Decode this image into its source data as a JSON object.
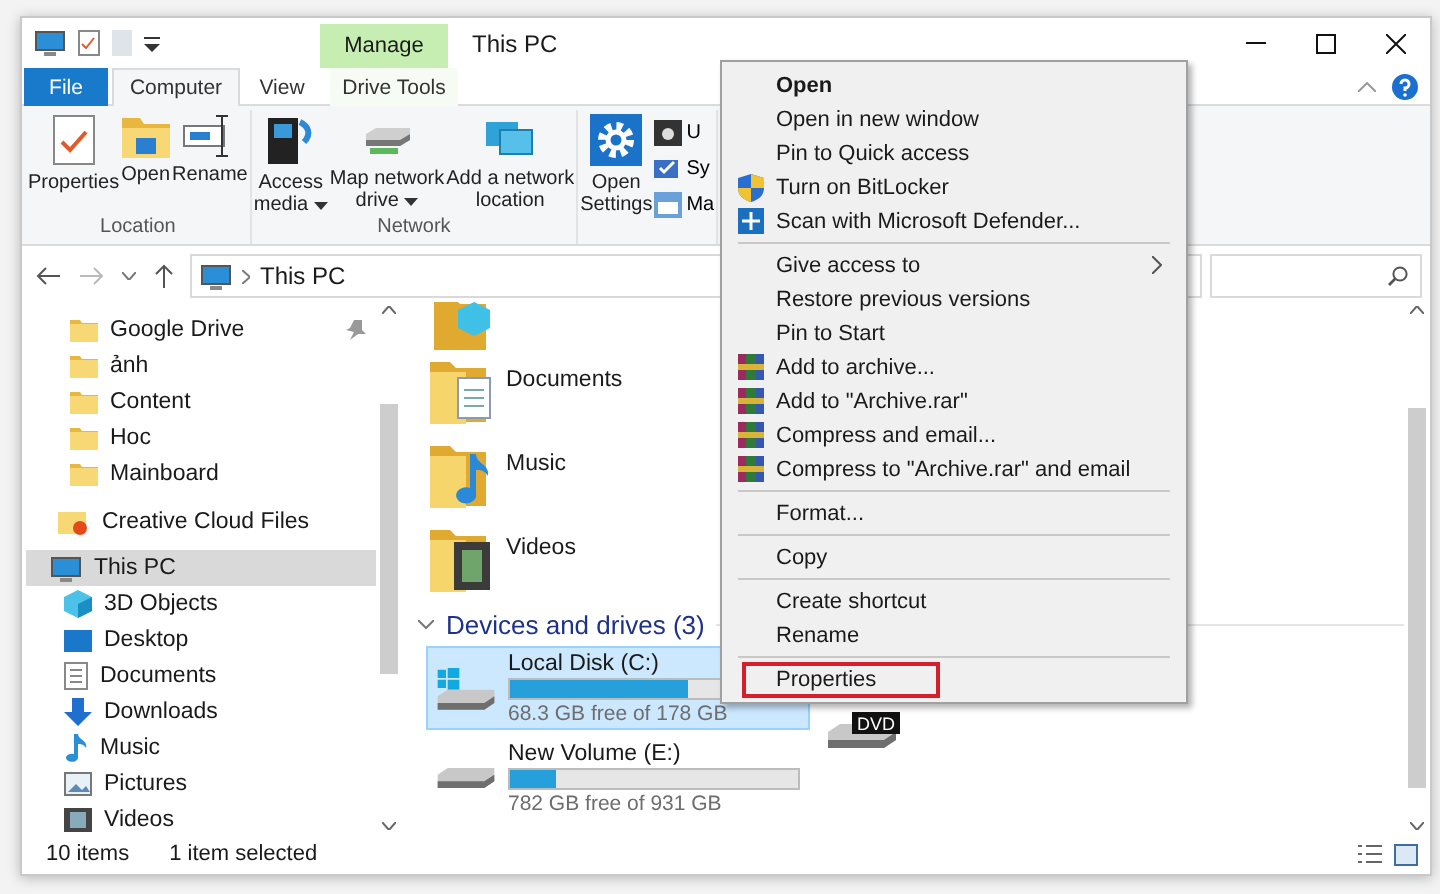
{
  "window": {
    "title": "This PC",
    "contextual_group": "Manage"
  },
  "ribbon_tabs": [
    {
      "label": "File",
      "kind": "file",
      "selected": false
    },
    {
      "label": "Computer",
      "kind": "tab",
      "selected": true
    },
    {
      "label": "View",
      "kind": "tab",
      "selected": false
    },
    {
      "label": "Drive Tools",
      "kind": "contextual",
      "selected": false
    }
  ],
  "ribbon_groups": [
    {
      "label": "Location",
      "commands": [
        {
          "label": "Properties"
        },
        {
          "label": "Open"
        },
        {
          "label": "Rename"
        }
      ]
    },
    {
      "label": "Network",
      "commands": [
        {
          "label": "Access\nmedia",
          "dropdown": true
        },
        {
          "label": "Map network\ndrive",
          "dropdown": true
        },
        {
          "label": "Add a network\nlocation"
        }
      ]
    },
    {
      "commands": [
        {
          "label": "Open\nSettings"
        }
      ],
      "small_commands": [
        "U",
        "Sy",
        "Ma"
      ]
    }
  ],
  "address": {
    "path": "This PC"
  },
  "sidebar": {
    "items": [
      {
        "label": "Google Drive",
        "kind": "folder",
        "pinned": true,
        "selected": false
      },
      {
        "label": "ảnh",
        "kind": "folder",
        "pinned": false,
        "selected": false
      },
      {
        "label": "Content",
        "kind": "folder",
        "pinned": false,
        "selected": false
      },
      {
        "label": "Hoc",
        "kind": "folder",
        "pinned": false,
        "selected": false
      },
      {
        "label": "Mainboard",
        "kind": "folder",
        "pinned": false,
        "selected": false
      },
      {
        "label": "Creative Cloud Files",
        "kind": "cloud",
        "pinned": false,
        "selected": false
      },
      {
        "label": "This PC",
        "kind": "pc",
        "pinned": false,
        "selected": true,
        "children": [
          {
            "label": "3D Objects",
            "kind": "cube",
            "pinned": false,
            "selected": false
          },
          {
            "label": "Desktop",
            "kind": "desktop",
            "pinned": false,
            "selected": false
          },
          {
            "label": "Documents",
            "kind": "documents",
            "pinned": false,
            "selected": false
          },
          {
            "label": "Downloads",
            "kind": "downloads",
            "pinned": false,
            "selected": false
          },
          {
            "label": "Music",
            "kind": "music",
            "pinned": false,
            "selected": false
          },
          {
            "label": "Pictures",
            "kind": "pictures",
            "pinned": false,
            "selected": false
          },
          {
            "label": "Videos",
            "kind": "videos",
            "pinned": false,
            "selected": false
          }
        ]
      }
    ]
  },
  "folders": [
    {
      "label": "Documents",
      "kind": "documents"
    },
    {
      "label": "Music",
      "kind": "music"
    },
    {
      "label": "Videos",
      "kind": "videos"
    }
  ],
  "drives": {
    "heading": "Devices and drives (3)",
    "expanded": true,
    "items": [
      {
        "kind": "system",
        "name": "Local Disk (C:)",
        "free": "68.3 GB free of 178 GB",
        "level": 0.62,
        "selected": true
      },
      {
        "kind": "dvd",
        "badge": "DVD",
        "selected": false
      },
      {
        "kind": "hdd",
        "name": "New Volume (E:)",
        "free": "782 GB free of 931 GB",
        "level": 0.16,
        "selected": false
      }
    ]
  },
  "status_bar": {
    "item_count": "10 items",
    "selection": "1 item selected"
  },
  "context_menu": [
    {
      "kind": "plain",
      "label": "Open",
      "bold": true,
      "highlighted": false
    },
    {
      "kind": "plain",
      "label": "Open in new window",
      "bold": false,
      "highlighted": false
    },
    {
      "kind": "plain",
      "label": "Pin to Quick access",
      "bold": false,
      "highlighted": false
    },
    {
      "kind": "shield",
      "label": "Turn on BitLocker",
      "bold": false,
      "highlighted": false
    },
    {
      "kind": "defender",
      "label": "Scan with Microsoft Defender...",
      "bold": false,
      "highlighted": false
    },
    {
      "kind": "separator"
    },
    {
      "kind": "submenu",
      "label": "Give access to",
      "bold": false,
      "highlighted": false
    },
    {
      "kind": "plain",
      "label": "Restore previous versions",
      "bold": false,
      "highlighted": false
    },
    {
      "kind": "plain",
      "label": "Pin to Start",
      "bold": false,
      "highlighted": false
    },
    {
      "kind": "archive",
      "label": "Add to archive...",
      "bold": false,
      "highlighted": false
    },
    {
      "kind": "archive",
      "label": "Add to \"Archive.rar\"",
      "bold": false,
      "highlighted": false
    },
    {
      "kind": "archive",
      "label": "Compress and email...",
      "bold": false,
      "highlighted": false
    },
    {
      "kind": "archive",
      "label": "Compress to \"Archive.rar\" and email",
      "bold": false,
      "highlighted": false
    },
    {
      "kind": "separator"
    },
    {
      "kind": "plain",
      "label": "Format...",
      "bold": false,
      "highlighted": false
    },
    {
      "kind": "separator"
    },
    {
      "kind": "plain",
      "label": "Copy",
      "bold": false,
      "highlighted": false
    },
    {
      "kind": "separator"
    },
    {
      "kind": "plain",
      "label": "Create shortcut",
      "bold": false,
      "highlighted": false
    },
    {
      "kind": "plain",
      "label": "Rename",
      "bold": false,
      "highlighted": false
    },
    {
      "kind": "separator"
    },
    {
      "kind": "plain",
      "label": "Properties",
      "bold": false,
      "highlighted": true
    }
  ]
}
